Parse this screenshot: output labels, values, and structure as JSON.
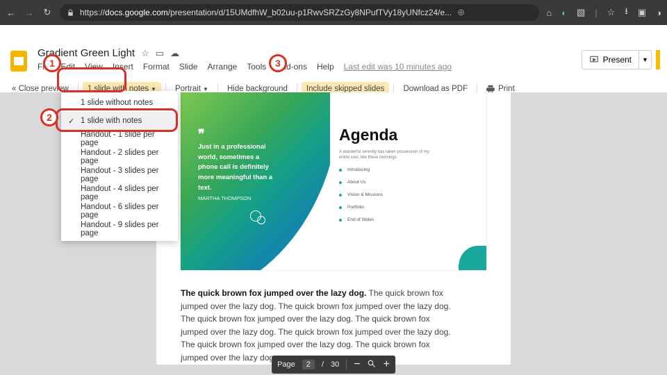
{
  "browser": {
    "url_prefix": "https://",
    "url_host": "docs.google.com",
    "url_path": "/presentation/d/15UMdfhW_b02uu-p1RwvSRZzGy8NPufTVy18yUNfcz24/e..."
  },
  "header": {
    "title": "Gradient Green Light",
    "menus": [
      "File",
      "Edit",
      "View",
      "Insert",
      "Format",
      "Slide",
      "Arrange",
      "Tools",
      "Add-ons",
      "Help"
    ],
    "last_edit": "Last edit was 10 minutes ago",
    "present": "Present"
  },
  "toolbar": {
    "close": "« Close preview",
    "layout": "1 slide with notes",
    "orientation": "Portrait",
    "hide_bg": "Hide background",
    "include_skipped": "Include skipped slides",
    "download": "Download as PDF",
    "print": "Print"
  },
  "dropdown": {
    "items": [
      "1 slide without notes",
      "1 slide with notes",
      "Handout - 1 slide per page",
      "Handout - 2 slides per page",
      "Handout - 3 slides per page",
      "Handout - 4 slides per page",
      "Handout - 6 slides per page",
      "Handout - 9 slides per page"
    ],
    "selected_index": 1
  },
  "slide": {
    "quote": "Just in a professional world, sometimes a phone call is definitely more meaningful than a text.",
    "author": "MARTHA THOMPSON",
    "agenda_title": "Agenda",
    "agenda_sub": "A wonderful serenity has taken possession of my entire soul, like these mornings",
    "bullets": [
      "Introducing",
      "About Us",
      "Vision & Missions",
      "Portfolio",
      "End of Slides"
    ]
  },
  "notes": {
    "bold": "The quick brown fox jumped over the lazy dog.",
    "rest": " The quick brown fox jumped over the lazy dog. The quick brown fox jumped over the lazy dog. The quick brown fox jumped over the lazy dog. The quick brown fox jumped over the lazy dog. The quick brown fox jumped over the lazy dog. The quick brown fox jumped over the lazy dog. The quick brown fox jumped over the lazy dog."
  },
  "pager": {
    "label": "Page",
    "current": "2",
    "sep": "/",
    "total": "30"
  },
  "markers": {
    "m1": "1",
    "m2": "2",
    "m3": "3"
  }
}
